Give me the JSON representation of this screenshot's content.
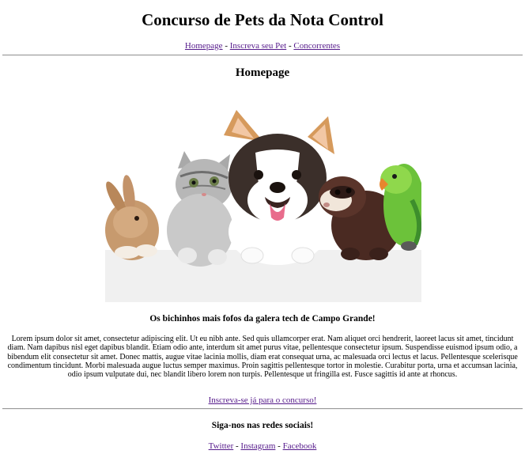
{
  "header": {
    "title": "Concurso de Pets da Nota Control"
  },
  "nav": {
    "items": [
      {
        "label": "Homepage"
      },
      {
        "label": "Inscreva seu Pet"
      },
      {
        "label": "Concorrentes"
      }
    ],
    "separator": " - "
  },
  "main": {
    "section_title": "Homepage",
    "hero_image": {
      "subject": "rabbit, kitten, corgi puppy, ferret and green parrot peeking over a blank banner"
    },
    "tagline": "Os bichinhos mais fofos da galera tech de Campo Grande!",
    "body_text": "Lorem ipsum dolor sit amet, consectetur adipiscing elit. Ut eu nibh ante. Sed quis ullamcorper erat. Nam aliquet orci hendrerit, laoreet lacus sit amet, tincidunt diam. Nam dapibus nisl eget dapibus blandit. Etiam odio ante, interdum sit amet purus vitae, pellentesque consectetur ipsum. Suspendisse euismod ipsum odio, a bibendum elit consectetur sit amet. Donec mattis, augue vitae lacinia mollis, diam erat consequat urna, ac malesuada orci lectus et lacus. Pellentesque scelerisque condimentum tincidunt. Morbi malesuada augue luctus semper maximus. Proin sagittis pellentesque tortor in molestie. Curabitur porta, urna et accumsan lacinia, odio ipsum vulputate dui, nec blandit libero lorem non turpis. Pellentesque ut fringilla est. Fusce sagittis id ante at rhoncus.",
    "cta_label": "Inscreva-se já para o concurso!"
  },
  "footer": {
    "title": "Siga-nos nas redes sociais!",
    "links": [
      {
        "label": "Twitter"
      },
      {
        "label": "Instagram"
      },
      {
        "label": "Facebook"
      }
    ],
    "separator": " - "
  },
  "colors": {
    "link": "#551a8b",
    "rule": "#9a9a9a",
    "banner": "#f0f0f0"
  }
}
